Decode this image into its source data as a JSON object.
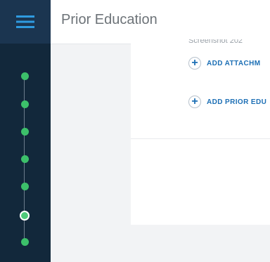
{
  "header": {
    "title": "Prior Education"
  },
  "menu": {
    "icon": "hamburger-menu-icon",
    "accent": "#1b3550"
  },
  "steps": {
    "count": 7,
    "current_index": 5,
    "color": "#3cc06a"
  },
  "card": {
    "cut_text": "Screenshot 202",
    "add_attachment_label": "ADD ATTACHM",
    "add_prior_education_label": "ADD PRIOR EDU"
  }
}
